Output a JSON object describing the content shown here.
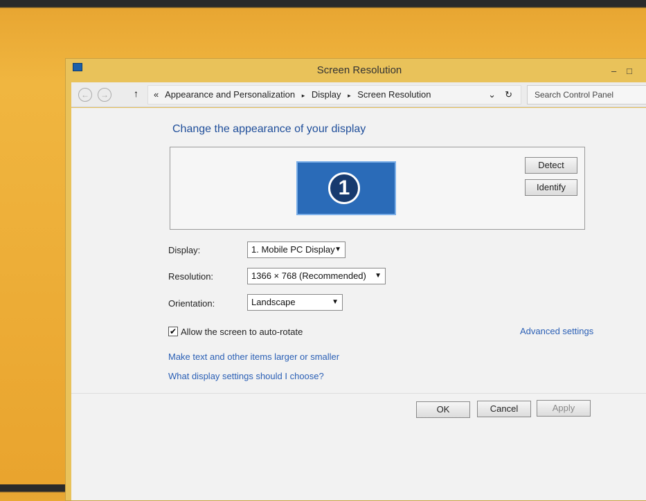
{
  "window": {
    "title": "Screen Resolution",
    "minimize": "–",
    "maximize": "□"
  },
  "address": {
    "back": "←",
    "forward": "→",
    "up": "↑",
    "overflow": "«",
    "crumbs": [
      "Appearance and Personalization",
      "Display",
      "Screen Resolution"
    ],
    "separator": "▸",
    "dropdown": "⌄",
    "refresh": "↻",
    "search_placeholder": "Search Control Panel"
  },
  "main": {
    "heading": "Change the appearance of your display",
    "monitor_number": "1",
    "detect": "Detect",
    "identify": "Identify",
    "display_label": "Display:",
    "display_value": "1. Mobile PC Display",
    "resolution_label": "Resolution:",
    "resolution_value": "1366 × 768 (Recommended)",
    "orientation_label": "Orientation:",
    "orientation_value": "Landscape",
    "autorotate_label": "Allow the screen to auto-rotate",
    "autorotate_checked": true,
    "advanced": "Advanced settings",
    "link1": "Make text and other items larger or smaller",
    "link2": "What display settings should I choose?",
    "ok": "OK",
    "cancel": "Cancel",
    "apply": "Apply"
  }
}
